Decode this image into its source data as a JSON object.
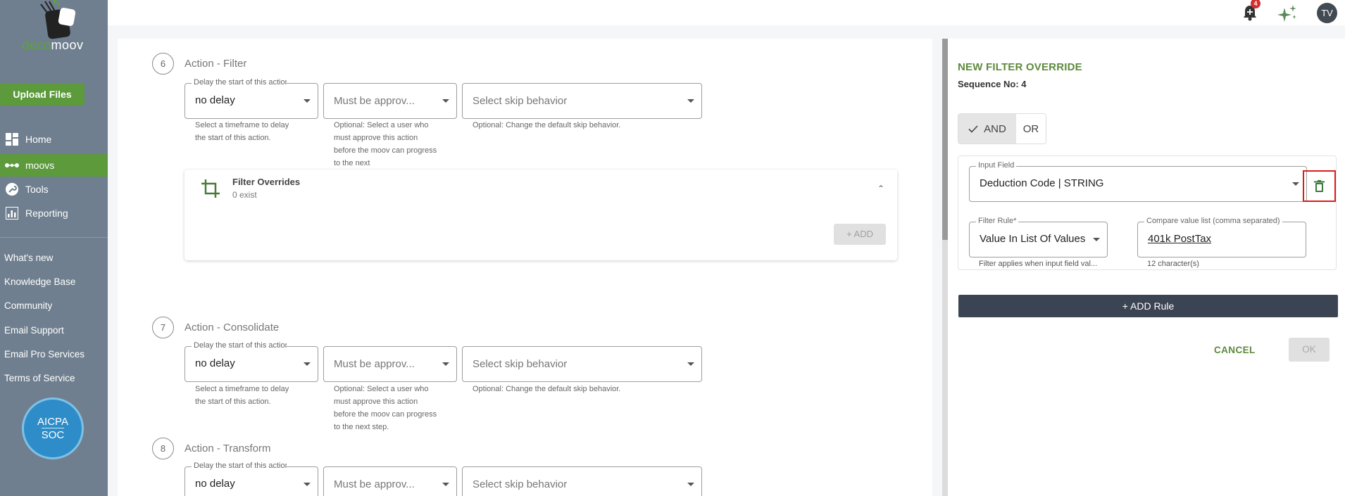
{
  "sidebar": {
    "logo_text_1": "deco",
    "logo_text_2": "moov",
    "upload_label": "Upload Files",
    "nav": [
      {
        "label": "Home",
        "icon": "dashboard-icon"
      },
      {
        "label": "moovs",
        "icon": "dots-icon",
        "active": true
      },
      {
        "label": "Tools",
        "icon": "wrench-icon"
      },
      {
        "label": "Reporting",
        "icon": "chart-icon"
      }
    ],
    "links": [
      "What's new",
      "Knowledge Base",
      "Community",
      "Email Support",
      "Email Pro Services",
      "Terms of Service"
    ],
    "badge": {
      "line1": "AICPA",
      "line2": "SOC"
    }
  },
  "topbar": {
    "notification_count": "4",
    "avatar_initials": "TV"
  },
  "steps": [
    {
      "number": "6",
      "title": "Action - Filter",
      "delay_label": "Delay the start of this action",
      "delay_value": "no delay",
      "approver_placeholder": "Must be approv...",
      "skip_placeholder": "Select skip behavior",
      "delay_helper": "Select a timeframe to delay the start of this action.",
      "approver_helper": "Optional: Select a user who must approve this action before the moov can progress to the next",
      "skip_helper": "Optional: Change the default skip behavior."
    },
    {
      "number": "7",
      "title": "Action - Consolidate",
      "delay_label": "Delay the start of this action",
      "delay_value": "no delay",
      "approver_placeholder": "Must be approv...",
      "skip_placeholder": "Select skip behavior",
      "delay_helper": "Select a timeframe to delay the start of this action.",
      "approver_helper": "Optional: Select a user who must approve this action before the moov can progress to the next step.",
      "skip_helper": "Optional: Change the default skip behavior."
    },
    {
      "number": "8",
      "title": "Action - Transform",
      "delay_label": "Delay the start of this action",
      "delay_value": "no delay",
      "approver_placeholder": "Must be approv...",
      "skip_placeholder": "Select skip behavior"
    }
  ],
  "filter_overrides": {
    "title": "Filter Overrides",
    "subtitle": "0 exist",
    "add_label": "+ ADD"
  },
  "panel": {
    "title": "NEW FILTER OVERRIDE",
    "sequence": "Sequence No: 4",
    "and_label": "AND",
    "or_label": "OR",
    "input_field_label": "Input Field",
    "input_field_value": "Deduction Code | STRING",
    "filter_rule_label": "Filter Rule*",
    "filter_rule_value": "Value In List Of Values",
    "filter_rule_helper": "Filter applies when input field val...",
    "compare_label": "Compare value list (comma separated)",
    "compare_value": "401k PostTax",
    "compare_helper": "12 character(s)",
    "add_rule_label": "+ ADD Rule",
    "cancel_label": "CANCEL",
    "ok_label": "OK"
  },
  "colors": {
    "sidebar_bg": "#6f7f8f",
    "accent_green": "#5c9a3c",
    "dark_button": "#3b4452",
    "highlight_red": "#e01b1b"
  }
}
